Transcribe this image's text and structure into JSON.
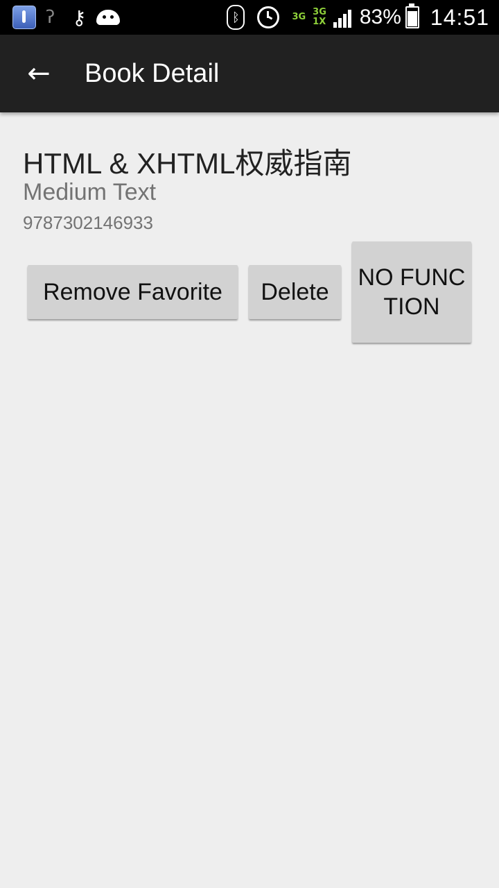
{
  "status_bar": {
    "network_primary": "3G",
    "network_secondary_top": "3G",
    "network_secondary_bottom": "1X",
    "battery_percent": "83%",
    "time": "14:51",
    "icons": [
      "thermometer-app-icon",
      "hearing-icon",
      "key-icon",
      "android-debug-icon",
      "bluetooth-icon",
      "alarm-icon",
      "signal-icon",
      "battery-charging-icon"
    ]
  },
  "app_bar": {
    "title": "Book Detail",
    "back_icon": "arrow-back-icon"
  },
  "book": {
    "title": "HTML & XHTML权威指南",
    "subtitle": "Medium Text",
    "isbn": "9787302146933"
  },
  "actions": {
    "remove_favorite": "Remove Favorite",
    "delete": "Delete",
    "no_function": "NO FUNCTION"
  },
  "colors": {
    "app_bar_bg": "#212121",
    "page_bg": "#eeeeee",
    "button_bg": "#d2d2d2",
    "network_green": "#8fd13a"
  }
}
